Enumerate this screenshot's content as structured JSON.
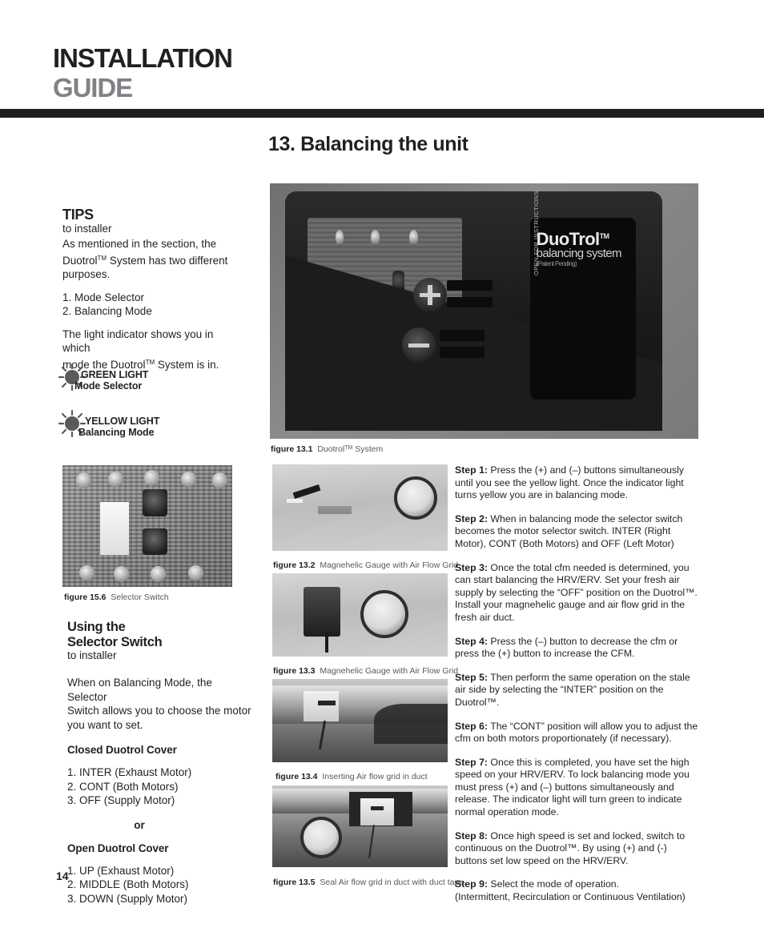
{
  "header": {
    "title": "INSTALLATION",
    "subtitle": "GUIDE"
  },
  "page_title": "13. Balancing the unit",
  "page_number": "14",
  "sidebar": {
    "tips_heading": "TIPS",
    "tips_sub": "to installer",
    "tips_intro_1": "As mentioned in the section, the",
    "tips_intro_2": "Duotrol",
    "tips_intro_3": " System has two different",
    "tips_intro_4": "purposes.",
    "tips_list": [
      "1. Mode Selector",
      "2. Balancing Mode"
    ],
    "tips_outro_1": "The light indicator shows you in which",
    "tips_outro_2": "mode the Duotrol",
    "tips_outro_3": " System is in.",
    "lights": [
      {
        "name": "GREEN LIGHT",
        "mode": "Mode Selector"
      },
      {
        "name": "YELLOW LIGHT",
        "mode": "Balancing Mode"
      }
    ],
    "figure_156": {
      "label": "figure 15.6",
      "caption": "Selector Switch"
    },
    "using_heading_line1": "Using the",
    "using_heading_line2": "Selector Switch",
    "using_sub": "to installer",
    "using_body_1": "When on Balancing Mode, the Selector",
    "using_body_2": "Switch allows you to choose the motor",
    "using_body_3": "you want to set.",
    "closed_cover_heading": "Closed Duotrol Cover",
    "closed_cover_list": [
      "1. INTER (Exhaust Motor)",
      "2. CONT (Both Motors)",
      "3. OFF (Supply Motor)"
    ],
    "or_label": "or",
    "open_cover_heading": "Open Duotrol Cover",
    "open_cover_list": [
      "1. UP (Exhaust Motor)",
      "2. MIDDLE (Both Motors)",
      "3. DOWN (Supply Motor)"
    ]
  },
  "main_figure": {
    "label": "figure 13.1",
    "caption_text": "Duotrol",
    "caption_suffix": " System",
    "device_logo_line1": "DuoTrol",
    "device_logo_line2": "balancing system",
    "device_logo_line3": "(Patent Pending)",
    "device_vertical_text": "OPEN FOR INSTRUCTIONS"
  },
  "figures": [
    {
      "label": "figure 13.2",
      "caption": "Magnehelic Gauge with Air Flow Grid"
    },
    {
      "label": "figure 13.3",
      "caption": "Magnehelic Gauge with Air Flow Grid"
    },
    {
      "label": "figure 13.4",
      "caption": "Inserting Air flow grid in duct"
    },
    {
      "label": "figure 13.5",
      "caption": "Seal Air flow grid in duct with duct tape."
    }
  ],
  "steps": [
    {
      "label": "Step 1:",
      "text": " Press the (+) and (–) buttons simultaneously until you see the yellow light. Once the indicator light turns yellow you are in balancing mode."
    },
    {
      "label": "Step 2:",
      "text": " When in balancing mode the selector switch becomes the motor selector switch. INTER (Right Motor), CONT (Both Motors) and OFF (Left Motor)"
    },
    {
      "label": "Step 3:",
      "text": " Once the total cfm needed is determined, you can start balancing the HRV/ERV. Set your fresh air supply by selecting the “OFF” position on the Duotrol™. Install your magnehelic gauge and air flow grid in the fresh air duct."
    },
    {
      "label": "Step 4:",
      "text": " Press the (–) button to decrease the cfm or press the (+) button to increase the CFM."
    },
    {
      "label": "Step 5:",
      "text": " Then perform the same operation on the stale air side by selecting the “INTER” position on the Duotrol™."
    },
    {
      "label": "Step 6:",
      "text": " The “CONT” position will allow you to adjust the cfm on both motors proportionately (if necessary)."
    },
    {
      "label": "Step 7:",
      "text": " Once this is completed, you have set the high speed on your HRV/ERV. To lock balancing mode you must press (+) and (–) buttons simultaneously and release. The indicator light will turn green to indicate normal operation mode."
    },
    {
      "label": "Step 8:",
      "text": " Once high speed is set and locked, switch to continuous on the Duotrol™.  By using (+) and (-) buttons set low speed on the HRV/ERV."
    },
    {
      "label": "Step 9:",
      "text": " Select the mode of operation.\n(Intermittent, Recirculation or Continuous Ventilation)"
    }
  ],
  "colors": {
    "ink": "#231f20",
    "gray_heading": "#808285",
    "caption_gray": "#58595b"
  }
}
